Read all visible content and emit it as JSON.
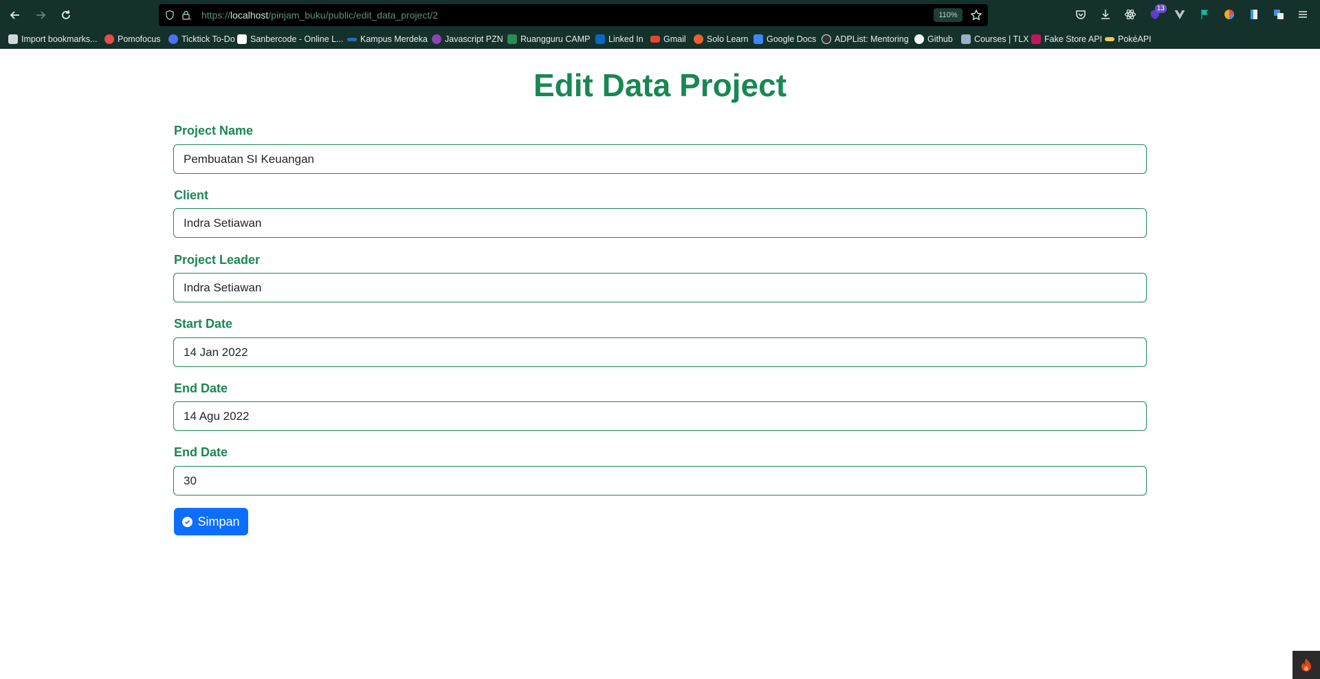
{
  "browser": {
    "url_prefix": "https://",
    "url_host": "localhost",
    "url_path": "/pinjam_buku/public/edit_data_project/2",
    "zoom": "110%",
    "extension_badge": "13",
    "bookmarks": [
      {
        "label": "Import bookmarks...",
        "icon": "import-icon",
        "color": "#cfd8dc"
      },
      {
        "label": "Pomofocus",
        "icon": "pomofocus-icon",
        "color": "#e84b4b"
      },
      {
        "label": "Ticktick To-Do",
        "icon": "ticktick-icon",
        "color": "#4a72f5"
      },
      {
        "label": "Sanbercode - Online L...",
        "icon": "sanbercode-icon",
        "color": "#ffffff"
      },
      {
        "label": "Kampus Merdeka",
        "icon": "kampus-merdeka-icon",
        "color": "#2b6cb0"
      },
      {
        "label": "Javascript PZN",
        "icon": "pzn-icon",
        "color": "#8e44ad"
      },
      {
        "label": "Ruangguru CAMP",
        "icon": "ruangguru-icon",
        "color": "#2e8b57"
      },
      {
        "label": "Linked In",
        "icon": "linkedin-icon",
        "color": "#0a66c2"
      },
      {
        "label": "Gmail",
        "icon": "gmail-icon",
        "color": "#ea4335"
      },
      {
        "label": "Solo Learn",
        "icon": "sololearn-icon",
        "color": "#e8622c"
      },
      {
        "label": "Google Docs",
        "icon": "google-docs-icon",
        "color": "#4285f4"
      },
      {
        "label": "ADPList: Mentoring",
        "icon": "adplist-icon",
        "color": "#333333"
      },
      {
        "label": "Github",
        "icon": "github-icon",
        "color": "#ffffff"
      },
      {
        "label": "Courses | TLX",
        "icon": "tlx-icon",
        "color": "#9ab0c8"
      },
      {
        "label": "Fake Store API",
        "icon": "fake-store-icon",
        "color": "#c2185b"
      },
      {
        "label": "PokéAPI",
        "icon": "pokeapi-icon",
        "color": "#f2c94c"
      }
    ]
  },
  "form": {
    "title": "Edit Data Project",
    "fields": [
      {
        "label": "Project Name",
        "value": "Pembuatan SI Keuangan"
      },
      {
        "label": "Client",
        "value": "Indra Setiawan"
      },
      {
        "label": "Project Leader",
        "value": "Indra Setiawan"
      },
      {
        "label": "Start Date",
        "value": "14 Jan 2022"
      },
      {
        "label": "End Date",
        "value": "14 Agu 2022"
      },
      {
        "label": "End Date",
        "value": "30"
      }
    ],
    "submit_label": "Simpan"
  },
  "colors": {
    "accent": "#198754",
    "button": "#0d6efd",
    "chrome": "#14312b"
  }
}
